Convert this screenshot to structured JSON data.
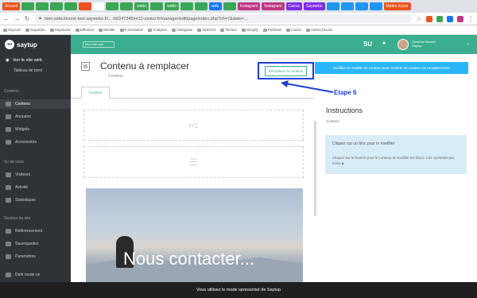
{
  "browser": {
    "tabs": [
      {
        "label": "Accueil",
        "color": "#e8541b"
      },
      {
        "label": "",
        "color": "#3aa755"
      },
      {
        "label": "",
        "color": "#3aa755"
      },
      {
        "label": "",
        "color": "#3aa755"
      },
      {
        "label": "",
        "color": "#3aa755"
      },
      {
        "label": "",
        "color": "#e8541b"
      },
      {
        "label": "",
        "color": "#ffffff",
        "active": true
      },
      {
        "label": "",
        "color": "#3aa755"
      },
      {
        "label": "",
        "color": "#3aa755"
      },
      {
        "label": "webo",
        "color": "#3aa755"
      },
      {
        "label": "",
        "color": "#3aa755"
      },
      {
        "label": "webo",
        "color": "#3aa755"
      },
      {
        "label": "",
        "color": "#3aa755"
      },
      {
        "label": "",
        "color": "#3aa755"
      },
      {
        "label": "web",
        "color": "#1877f2"
      },
      {
        "label": "",
        "color": "#3aa755"
      },
      {
        "label": "Instagram",
        "color": "#c13584"
      },
      {
        "label": "Instagram",
        "color": "#c13584"
      },
      {
        "label": "Canva",
        "color": "#7d2ae8"
      },
      {
        "label": "Saywebo",
        "color": "#7d2ae8"
      },
      {
        "label": "",
        "color": "#2196f3"
      },
      {
        "label": "",
        "color": "#2196f3"
      },
      {
        "label": "",
        "color": "#2196f3"
      },
      {
        "label": "",
        "color": "#2196f3"
      },
      {
        "label": "Mettre à jour",
        "color": "#e8541b"
      }
    ],
    "url": "bien-sélectionné-test.saywebo.fr/…/id/247345/m12-zestor.fr/manager/edit/page/index.php?ch=7&date=…",
    "bookmarks": [
      "Sayvote",
      "Saywebo",
      "Sayebook",
      "Diffusion",
      "Mireille",
      "Formulaires",
      "Analytics",
      "Instagram",
      "TestGrid",
      "Tâches",
      "Shopify",
      "Publicité",
      "Canva",
      "Autres favoris"
    ]
  },
  "header": {
    "brand": "saytup",
    "site_label": "Mon site web",
    "su": "SU",
    "user_line1": "Sandrine Monteil",
    "user_line2": "Saytup"
  },
  "sidebar": {
    "top_item": "Voir le site web",
    "top_sub": "Tableau de bord",
    "section_contenu": "Contenu",
    "items_contenu": [
      "Contenu",
      "Annuaire",
      "Widgets",
      "Accessoires"
    ],
    "section_vu": "Vu de vous",
    "items_vu": [
      "Visiteurs",
      "Activité",
      "Statistiques"
    ],
    "section_gestion": "Gestion du site",
    "items_gestion": [
      "Référencement",
      "Sauvegardes",
      "Paramètres"
    ],
    "bottom_item": "Dark mode on"
  },
  "main": {
    "title": "Contenu à remplacer",
    "subtitle": "Contenu",
    "replace_button": "Remplacer le contenu",
    "modify_button": "Modifier le modèle de contenu avec modèle de contenu ou remplacement",
    "annotation": "Etape 6",
    "content_tab": "Contenu",
    "block_h1": "H1",
    "image_caption": "Nous contacter...",
    "instructions_title": "Instructions",
    "instructions_sub": "Contenu",
    "info_heading": "Cliquez sur un bloc pour le modifier",
    "info_text": "Cliquez sur le bouton pour le contenu et modifier les blocs. Les symboles par icône"
  },
  "footer": {
    "text": "Vous utilisez le mode sponsorisé de Saytup"
  },
  "colors": {
    "accent": "#3aae8f",
    "sidebar_bg": "#2f3338",
    "annotation_blue": "#1e40d6",
    "button_blue": "#29b6f6",
    "info_bg": "#d8ecf7"
  }
}
